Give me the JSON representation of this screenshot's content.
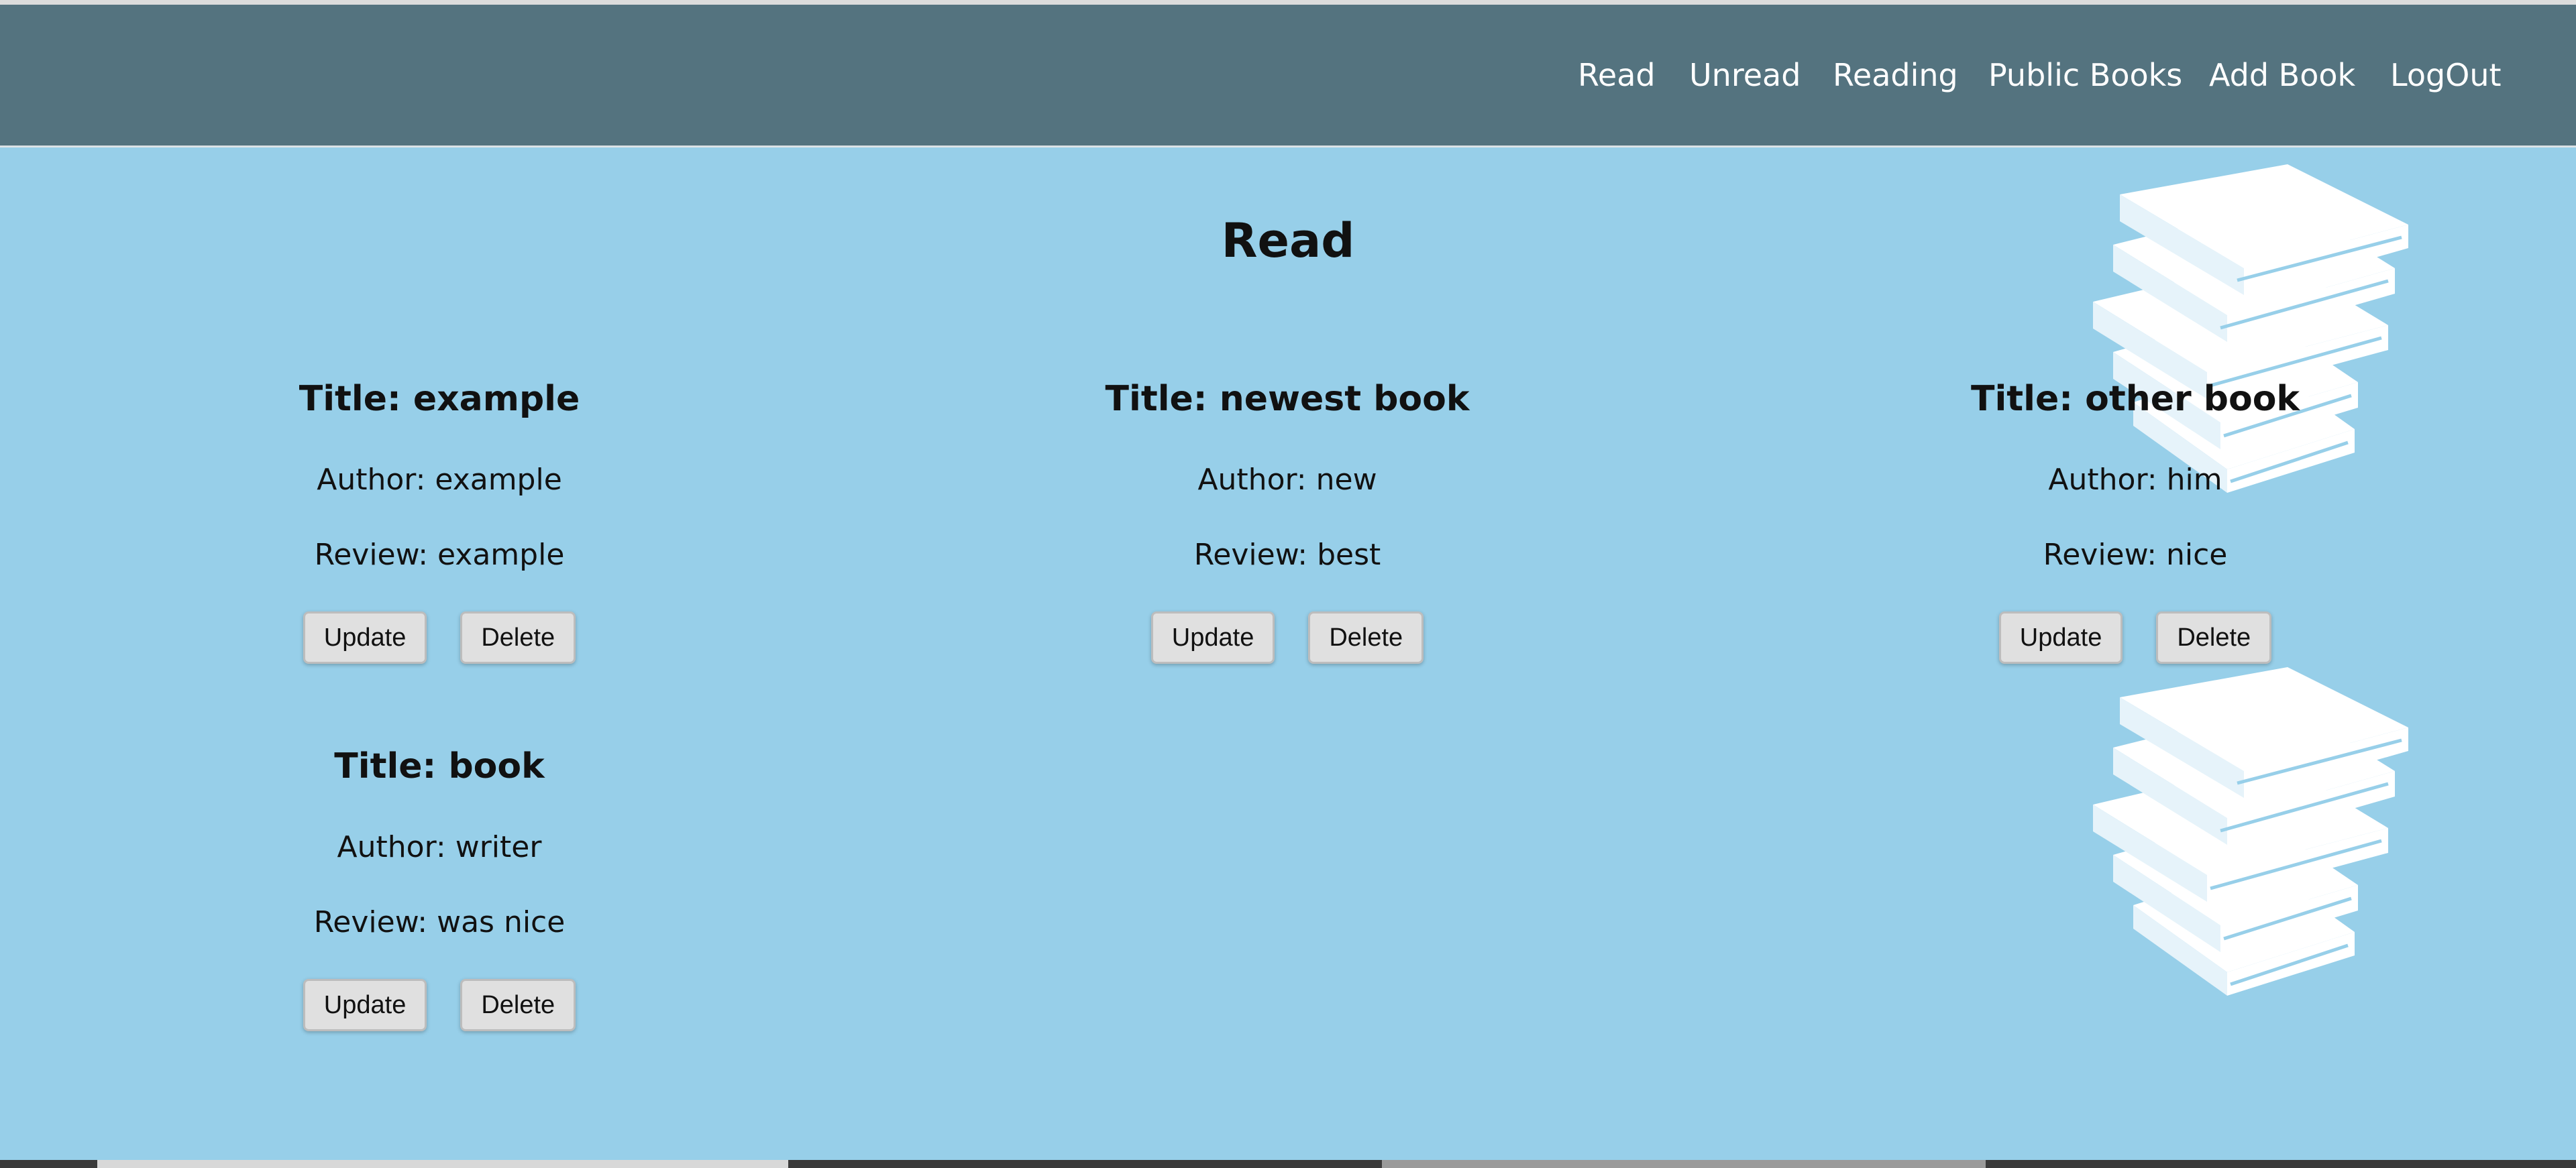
{
  "nav": {
    "links": [
      "Read",
      "Unread",
      "Reading",
      "Public Books",
      "Add Book",
      "LogOut"
    ]
  },
  "page": {
    "title": "Read"
  },
  "books": [
    {
      "title": "Title: example",
      "author": "Author: example",
      "review": "Review: example",
      "update_label": "Update",
      "delete_label": "Delete"
    },
    {
      "title": "Title: newest book",
      "author": "Author: new",
      "review": "Review: best",
      "update_label": "Update",
      "delete_label": "Delete"
    },
    {
      "title": "Title: other book",
      "author": "Author: him",
      "review": "Review: nice",
      "update_label": "Update",
      "delete_label": "Delete"
    },
    {
      "title": "Title: book",
      "author": "Author: writer",
      "review": "Review: was nice",
      "update_label": "Update",
      "delete_label": "Delete"
    }
  ],
  "colors": {
    "navbar": "#54737f",
    "background": "#97cfe9",
    "nav_text": "#ffffff",
    "button": "#e0e0e0"
  },
  "icons": {
    "background_art": "stack-of-books-icon"
  }
}
